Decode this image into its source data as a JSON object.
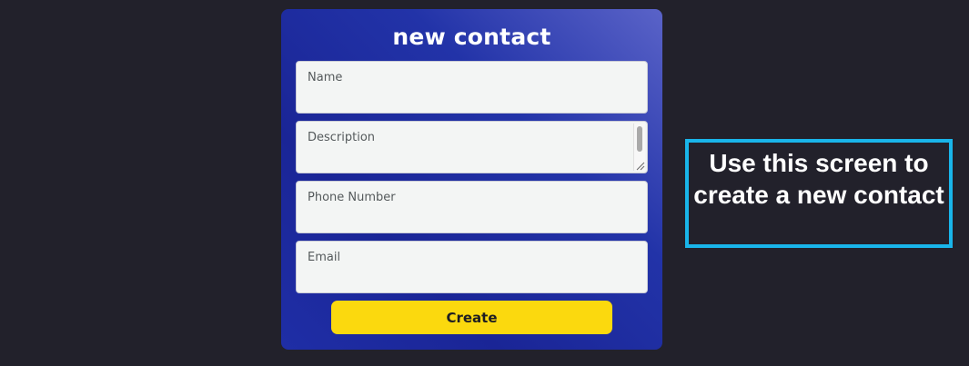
{
  "form": {
    "title": "new contact",
    "fields": [
      {
        "placeholder": "Name",
        "value": ""
      },
      {
        "placeholder": "Description",
        "value": ""
      },
      {
        "placeholder": "Phone Number",
        "value": ""
      },
      {
        "placeholder": "Email",
        "value": ""
      }
    ],
    "submit_label": "Create"
  },
  "callout": {
    "text": "Use this screen to create a new contact"
  },
  "colors": {
    "background": "#22212b",
    "card": "#1f2ea6",
    "button": "#fbd90e",
    "callout_border": "#19b5ea"
  }
}
